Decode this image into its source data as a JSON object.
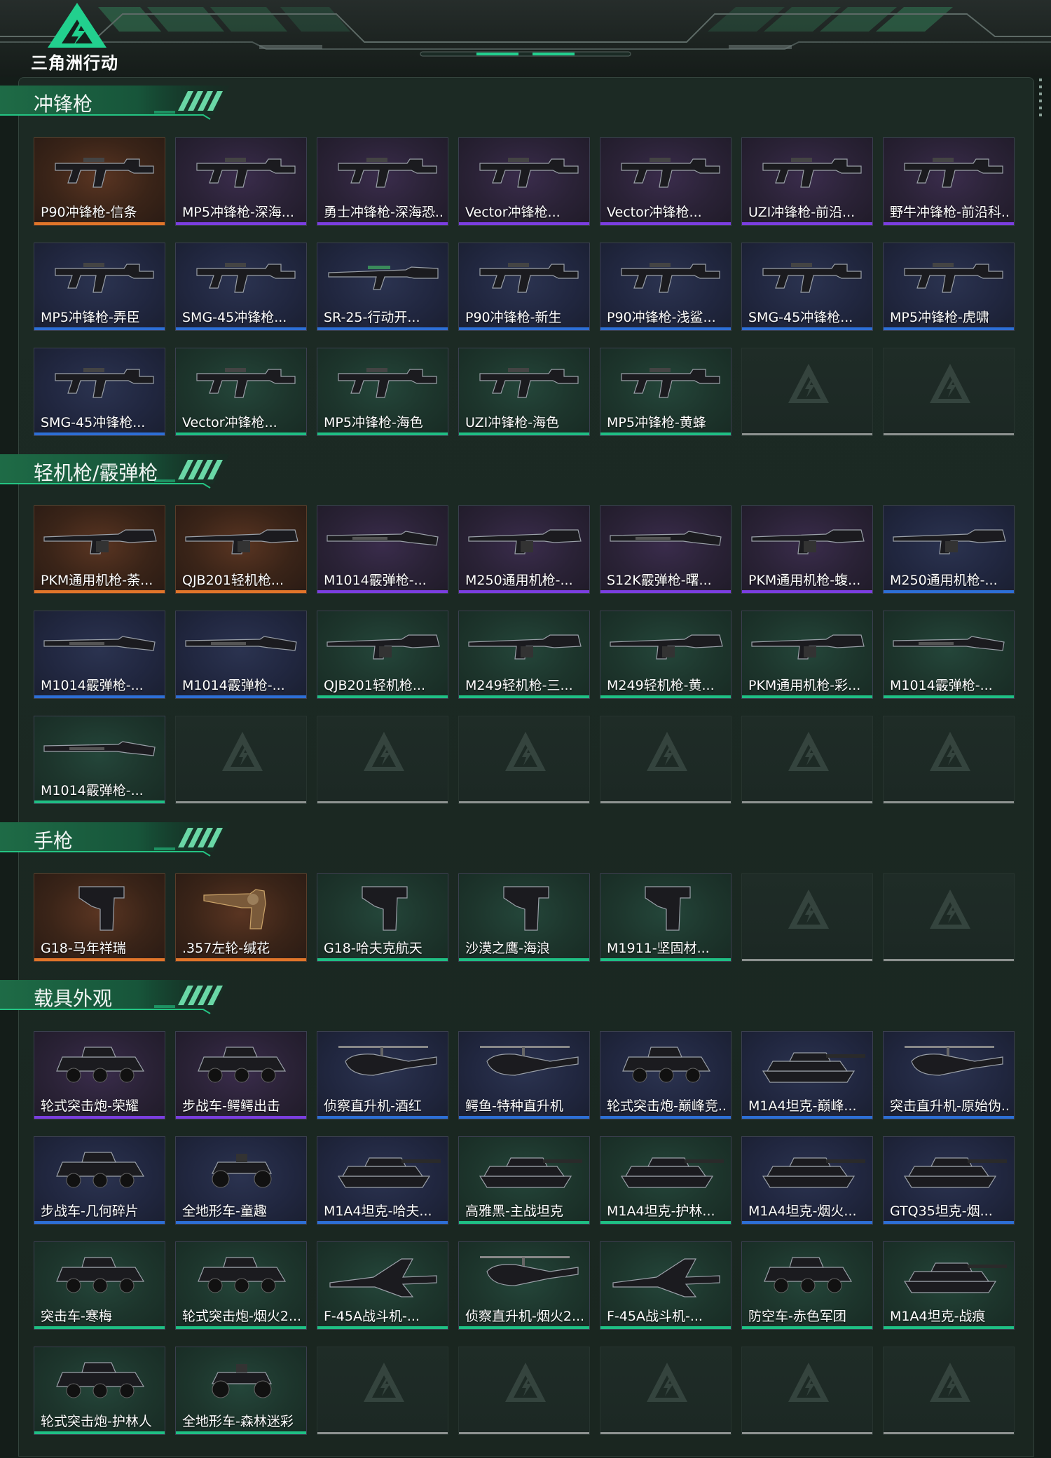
{
  "app": {
    "logo_text": "三角洲行动"
  },
  "colors": {
    "gold": "#e0752a",
    "purple": "#7b3ee0",
    "blue": "#2d6fd6",
    "green": "#1fbf84",
    "empty": "#8c918f",
    "accent": "#22d08e"
  },
  "sections": [
    {
      "title": "冲锋枪",
      "items": [
        {
          "label": "P90冲锋枪-信条",
          "rarity": "gold",
          "icon": "smg-icon"
        },
        {
          "label": "MP5冲锋枪-深海...",
          "rarity": "purple",
          "icon": "smg-icon"
        },
        {
          "label": "勇士冲锋枪-深海恐...",
          "rarity": "purple",
          "icon": "smg-icon"
        },
        {
          "label": "Vector冲锋枪...",
          "rarity": "purple",
          "icon": "smg-icon"
        },
        {
          "label": "Vector冲锋枪...",
          "rarity": "purple",
          "icon": "smg-icon"
        },
        {
          "label": "UZI冲锋枪-前沿...",
          "rarity": "purple",
          "icon": "smg-icon"
        },
        {
          "label": "野牛冲锋枪-前沿科...",
          "rarity": "purple",
          "icon": "smg-icon"
        },
        {
          "label": "MP5冲锋枪-弄臣",
          "rarity": "blue",
          "icon": "smg-icon"
        },
        {
          "label": "SMG-45冲锋枪...",
          "rarity": "blue",
          "icon": "smg-icon"
        },
        {
          "label": "SR-25-行动开...",
          "rarity": "blue",
          "icon": "rifle-icon"
        },
        {
          "label": "P90冲锋枪-新生",
          "rarity": "blue",
          "icon": "smg-icon"
        },
        {
          "label": "P90冲锋枪-浅鲨...",
          "rarity": "blue",
          "icon": "smg-icon"
        },
        {
          "label": "SMG-45冲锋枪...",
          "rarity": "blue",
          "icon": "smg-icon"
        },
        {
          "label": "MP5冲锋枪-虎啸",
          "rarity": "blue",
          "icon": "smg-icon"
        },
        {
          "label": "SMG-45冲锋枪...",
          "rarity": "blue",
          "icon": "smg-icon"
        },
        {
          "label": "Vector冲锋枪...",
          "rarity": "green",
          "icon": "smg-icon"
        },
        {
          "label": "MP5冲锋枪-海色",
          "rarity": "green",
          "icon": "smg-icon"
        },
        {
          "label": "UZI冲锋枪-海色",
          "rarity": "green",
          "icon": "smg-icon"
        },
        {
          "label": "MP5冲锋枪-黄蜂",
          "rarity": "green",
          "icon": "smg-icon"
        }
      ]
    },
    {
      "title": "轻机枪/霰弹枪",
      "items": [
        {
          "label": "PKM通用机枪-荼...",
          "rarity": "gold",
          "icon": "lmg-icon"
        },
        {
          "label": "QJB201轻机枪...",
          "rarity": "gold",
          "icon": "lmg-icon"
        },
        {
          "label": "M1014霰弹枪-...",
          "rarity": "purple",
          "icon": "shotgun-icon"
        },
        {
          "label": "M250通用机枪-...",
          "rarity": "purple",
          "icon": "lmg-icon"
        },
        {
          "label": "S12K霰弹枪-曙...",
          "rarity": "purple",
          "icon": "shotgun-icon"
        },
        {
          "label": "PKM通用机枪-蝮...",
          "rarity": "purple",
          "icon": "lmg-icon"
        },
        {
          "label": "M250通用机枪-...",
          "rarity": "blue",
          "icon": "lmg-icon"
        },
        {
          "label": "M1014霰弹枪-...",
          "rarity": "blue",
          "icon": "shotgun-icon"
        },
        {
          "label": "M1014霰弹枪-...",
          "rarity": "blue",
          "icon": "shotgun-icon"
        },
        {
          "label": "QJB201轻机枪...",
          "rarity": "green",
          "icon": "lmg-icon"
        },
        {
          "label": "M249轻机枪-三...",
          "rarity": "green",
          "icon": "lmg-icon"
        },
        {
          "label": "M249轻机枪-黄...",
          "rarity": "green",
          "icon": "lmg-icon"
        },
        {
          "label": "PKM通用机枪-彩...",
          "rarity": "green",
          "icon": "lmg-icon"
        },
        {
          "label": "M1014霰弹枪-...",
          "rarity": "green",
          "icon": "shotgun-icon"
        },
        {
          "label": "M1014霰弹枪-...",
          "rarity": "green",
          "icon": "shotgun-icon"
        }
      ]
    },
    {
      "title": "手枪",
      "items": [
        {
          "label": "G18-马年祥瑞",
          "rarity": "gold",
          "icon": "pistol-icon"
        },
        {
          "label": ".357左轮-缄花",
          "rarity": "gold",
          "icon": "revolver-icon"
        },
        {
          "label": "G18-哈夫克航天",
          "rarity": "green",
          "icon": "pistol-icon"
        },
        {
          "label": "沙漠之鹰-海浪",
          "rarity": "green",
          "icon": "pistol-icon"
        },
        {
          "label": "M1911-坚固材...",
          "rarity": "green",
          "icon": "pistol-icon"
        }
      ]
    },
    {
      "title": "载具外观",
      "items": [
        {
          "label": "轮式突击炮-荣耀",
          "rarity": "purple",
          "icon": "armored-car-icon"
        },
        {
          "label": "步战车-鳄鳄出击",
          "rarity": "purple",
          "icon": "armored-car-icon"
        },
        {
          "label": "侦察直升机-酒红",
          "rarity": "blue",
          "icon": "helicopter-icon"
        },
        {
          "label": "鳄鱼-特种直升机",
          "rarity": "blue",
          "icon": "helicopter-icon"
        },
        {
          "label": "轮式突击炮-巅峰竞...",
          "rarity": "blue",
          "icon": "armored-car-icon"
        },
        {
          "label": "M1A4坦克-巅峰...",
          "rarity": "blue",
          "icon": "tank-icon"
        },
        {
          "label": "突击直升机-原始伪...",
          "rarity": "blue",
          "icon": "helicopter-icon"
        },
        {
          "label": "步战车-几何碎片",
          "rarity": "blue",
          "icon": "armored-car-icon"
        },
        {
          "label": "全地形车-童趣",
          "rarity": "blue",
          "icon": "atv-icon"
        },
        {
          "label": "M1A4坦克-哈夫...",
          "rarity": "blue",
          "icon": "tank-icon"
        },
        {
          "label": "高雅黑-主战坦克",
          "rarity": "green",
          "icon": "tank-icon"
        },
        {
          "label": "M1A4坦克-护林...",
          "rarity": "green",
          "icon": "tank-icon"
        },
        {
          "label": "M1A4坦克-烟火...",
          "rarity": "blue",
          "icon": "tank-icon"
        },
        {
          "label": "GTQ35坦克-烟...",
          "rarity": "blue",
          "icon": "tank-icon"
        },
        {
          "label": "突击车-寒梅",
          "rarity": "green",
          "icon": "armored-car-icon"
        },
        {
          "label": "轮式突击炮-烟火2...",
          "rarity": "green",
          "icon": "armored-car-icon"
        },
        {
          "label": "F-45A战斗机-...",
          "rarity": "green",
          "icon": "jet-icon"
        },
        {
          "label": "侦察直升机-烟火2...",
          "rarity": "green",
          "icon": "helicopter-icon"
        },
        {
          "label": "F-45A战斗机-...",
          "rarity": "green",
          "icon": "jet-icon"
        },
        {
          "label": "防空车-赤色军团",
          "rarity": "green",
          "icon": "armored-car-icon"
        },
        {
          "label": "M1A4坦克-战痕",
          "rarity": "green",
          "icon": "tank-icon"
        },
        {
          "label": "轮式突击炮-护林人",
          "rarity": "green",
          "icon": "armored-car-icon"
        },
        {
          "label": "全地形车-森林迷彩",
          "rarity": "green",
          "icon": "atv-icon"
        }
      ]
    }
  ]
}
